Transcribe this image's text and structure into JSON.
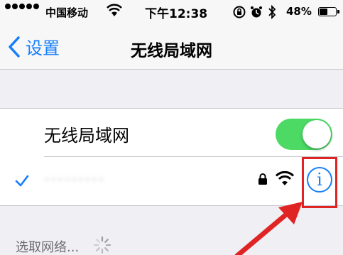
{
  "status_bar": {
    "carrier": "中国移动",
    "time": "下午12:38",
    "battery_percent": "48%",
    "battery_level": 0.48,
    "signal_dots": 5
  },
  "nav": {
    "back_label": "设置",
    "title": "无线局域网"
  },
  "wifi_toggle": {
    "label": "无线局域网",
    "on": true,
    "color": "#4cd964"
  },
  "network": {
    "name": "·········",
    "connected": true,
    "secured": true
  },
  "choose_network_label": "选取网络...",
  "colors": {
    "accent": "#157efb",
    "highlight": "#e02424"
  }
}
